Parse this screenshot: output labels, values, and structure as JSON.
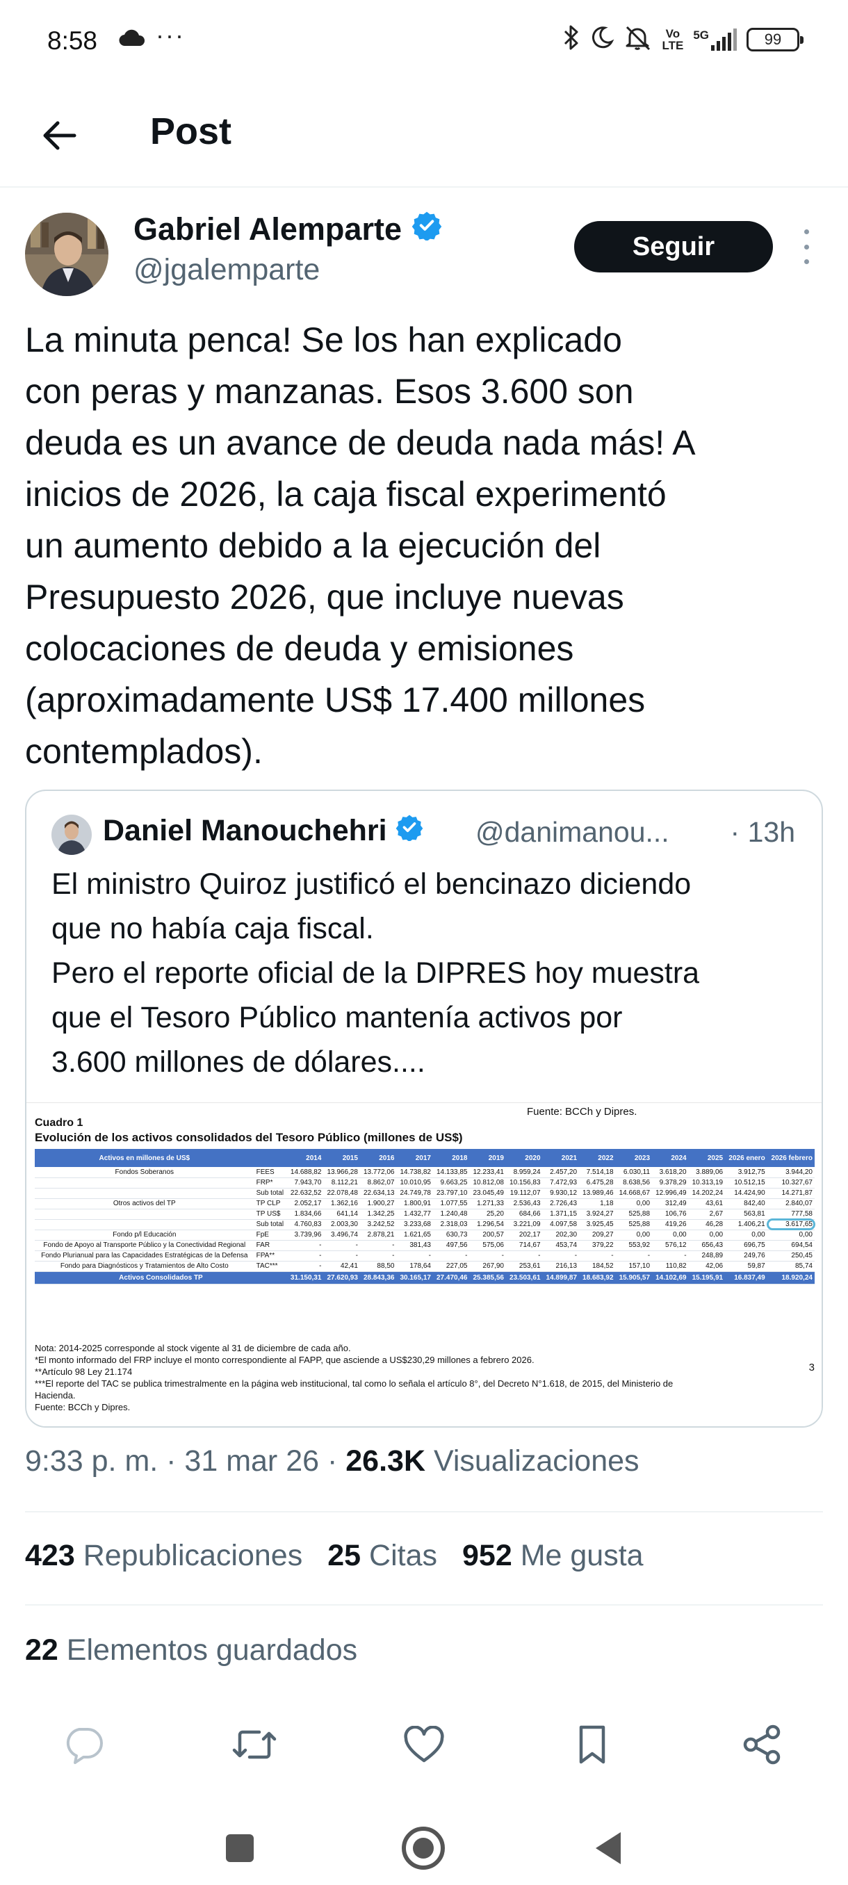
{
  "status_bar": {
    "time": "8:58",
    "dots": "···",
    "volte_top": "Vo",
    "volte_bottom": "LTE",
    "network": "5G",
    "battery": "99"
  },
  "header": {
    "title": "Post"
  },
  "author": {
    "name": "Gabriel Alemparte",
    "handle": "@jgalemparte",
    "follow_label": "Seguir",
    "verified": true
  },
  "tweet": {
    "text": "La minuta penca! Se los han explicado\ncon peras y manzanas. Esos 3.600 son\ndeuda es un avance de deuda nada más! A\ninicios de 2026, la caja fiscal experimentó\nun aumento debido a la ejecución del\nPresupuesto 2026, que incluye nuevas\ncolocaciones de deuda y emisiones\n(aproximadamente US$ 17.400 millones\ncontemplados).",
    "timestamp": "9:33 p. m. · 31 mar 26 · ",
    "views_count": "26.3K",
    "views_label": " Visualizaciones"
  },
  "quote": {
    "name": "Daniel Manouchehri",
    "handle": "@danimanou...",
    "time": "· 13h",
    "text": "El ministro Quiroz justificó el bencinazo diciendo\nque no había caja fiscal.\nPero el reporte oficial de la DIPRES hoy muestra\nque el Tesoro Público mantenía activos por\n3.600 millones de dólares....",
    "image": {
      "source": "Fuente: BCCh y Dipres.",
      "cuadro": "Cuadro 1",
      "title": "Evolución de los activos consolidados del Tesoro Público (millones de US$)",
      "header": [
        "Activos en millones de US$",
        "",
        "2014",
        "2015",
        "2016",
        "2017",
        "2018",
        "2019",
        "2020",
        "2021",
        "2022",
        "2023",
        "2024",
        "2025",
        "2026 enero",
        "2026 febrero"
      ],
      "rows": [
        {
          "group": "Fondos Soberanos",
          "code": "FEES",
          "values": [
            "14.688,82",
            "13.966,28",
            "13.772,06",
            "14.738,82",
            "14.133,85",
            "12.233,41",
            "8.959,24",
            "2.457,20",
            "7.514,18",
            "6.030,11",
            "3.618,20",
            "3.889,06",
            "3.912,75",
            "3.944,20"
          ]
        },
        {
          "group": "",
          "code": "FRP*",
          "values": [
            "7.943,70",
            "8.112,21",
            "8.862,07",
            "10.010,95",
            "9.663,25",
            "10.812,08",
            "10.156,83",
            "7.472,93",
            "6.475,28",
            "8.638,56",
            "9.378,29",
            "10.313,19",
            "10.512,15",
            "10.327,67"
          ]
        },
        {
          "group": "",
          "code": "Sub total",
          "values": [
            "22.632,52",
            "22.078,48",
            "22.634,13",
            "24.749,78",
            "23.797,10",
            "23.045,49",
            "19.112,07",
            "9.930,12",
            "13.989,46",
            "14.668,67",
            "12.996,49",
            "14.202,24",
            "14.424,90",
            "14.271,87"
          ]
        },
        {
          "group": "Otros activos del TP",
          "code": "TP CLP",
          "values": [
            "2.052,17",
            "1.362,16",
            "1.900,27",
            "1.800,91",
            "1.077,55",
            "1.271,33",
            "2.536,43",
            "2.726,43",
            "1,18",
            "0,00",
            "312,49",
            "43,61",
            "842,40",
            "2.840,07"
          ]
        },
        {
          "group": "",
          "code": "TP US$",
          "values": [
            "1.834,66",
            "641,14",
            "1.342,25",
            "1.432,77",
            "1.240,48",
            "25,20",
            "684,66",
            "1.371,15",
            "3.924,27",
            "525,88",
            "106,76",
            "2,67",
            "563,81",
            "777,58"
          ]
        },
        {
          "group": "",
          "code": "Sub total",
          "values": [
            "4.760,83",
            "2.003,30",
            "3.242,52",
            "3.233,68",
            "2.318,03",
            "1.296,54",
            "3.221,09",
            "4.097,58",
            "3.925,45",
            "525,88",
            "419,26",
            "46,28",
            "1.406,21",
            "3.617,65"
          ]
        },
        {
          "group": "Fondo p/l Educación",
          "code": "FpE",
          "values": [
            "3.739,96",
            "3.496,74",
            "2.878,21",
            "1.621,65",
            "630,73",
            "200,57",
            "202,17",
            "202,30",
            "209,27",
            "0,00",
            "0,00",
            "0,00",
            "0,00",
            "0,00"
          ]
        },
        {
          "group": "Fondo de Apoyo al Transporte Público y la Conectividad Regional",
          "code": "FAR",
          "values": [
            "-",
            "-",
            "-",
            "381,43",
            "497,56",
            "575,06",
            "714,67",
            "453,74",
            "379,22",
            "553,92",
            "576,12",
            "656,43",
            "696,75",
            "694,54"
          ]
        },
        {
          "group": "Fondo Plurianual para las Capacidades Estratégicas de la Defensa",
          "code": "FPA**",
          "values": [
            "-",
            "-",
            "-",
            "-",
            "-",
            "-",
            "-",
            "-",
            "-",
            "-",
            "-",
            "248,89",
            "249,76",
            "250,45"
          ]
        },
        {
          "group": "Fondo para Diagnósticos y Tratamientos de Alto Costo",
          "code": "TAC***",
          "values": [
            "-",
            "42,41",
            "88,50",
            "178,64",
            "227,05",
            "267,90",
            "253,61",
            "216,13",
            "184,52",
            "157,10",
            "110,82",
            "42,06",
            "59,87",
            "85,74"
          ]
        }
      ],
      "total": {
        "label": "Activos Consolidados TP",
        "values": [
          "31.150,31",
          "27.620,93",
          "28.843,36",
          "30.165,17",
          "27.470,46",
          "25.385,56",
          "23.503,61",
          "14.899,87",
          "18.683,92",
          "15.905,57",
          "14.102,69",
          "15.195,91",
          "16.837,49",
          "18.920,24"
        ]
      },
      "notes": "Nota: 2014-2025 corresponde al stock vigente al 31 de diciembre de cada año.\n*El monto informado del FRP incluye el monto correspondiente al FAPP, que asciende a US$230,29 millones a febrero 2026.\n**Artículo 98 Ley 21.174\n***El reporte del TAC se publica trimestralmente en la página web institucional, tal como lo señala el artículo 8°, del Decreto N°1.618, de 2015, del Ministerio de\nHacienda.\nFuente: BCCh y Dipres.",
      "page": "3"
    }
  },
  "stats": {
    "reposts_count": "423",
    "reposts_label": " Republicaciones",
    "quotes_count": "25",
    "quotes_label": " Citas",
    "likes_count": "952",
    "likes_label": " Me gusta",
    "saved_count": "22",
    "saved_label": " Elementos guardados"
  },
  "icons": {
    "reply": "reply-icon",
    "repost": "repost-icon",
    "like": "heart-icon",
    "bookmark": "bookmark-icon",
    "share": "share-icon",
    "verified_color": "#1d9bf0"
  }
}
